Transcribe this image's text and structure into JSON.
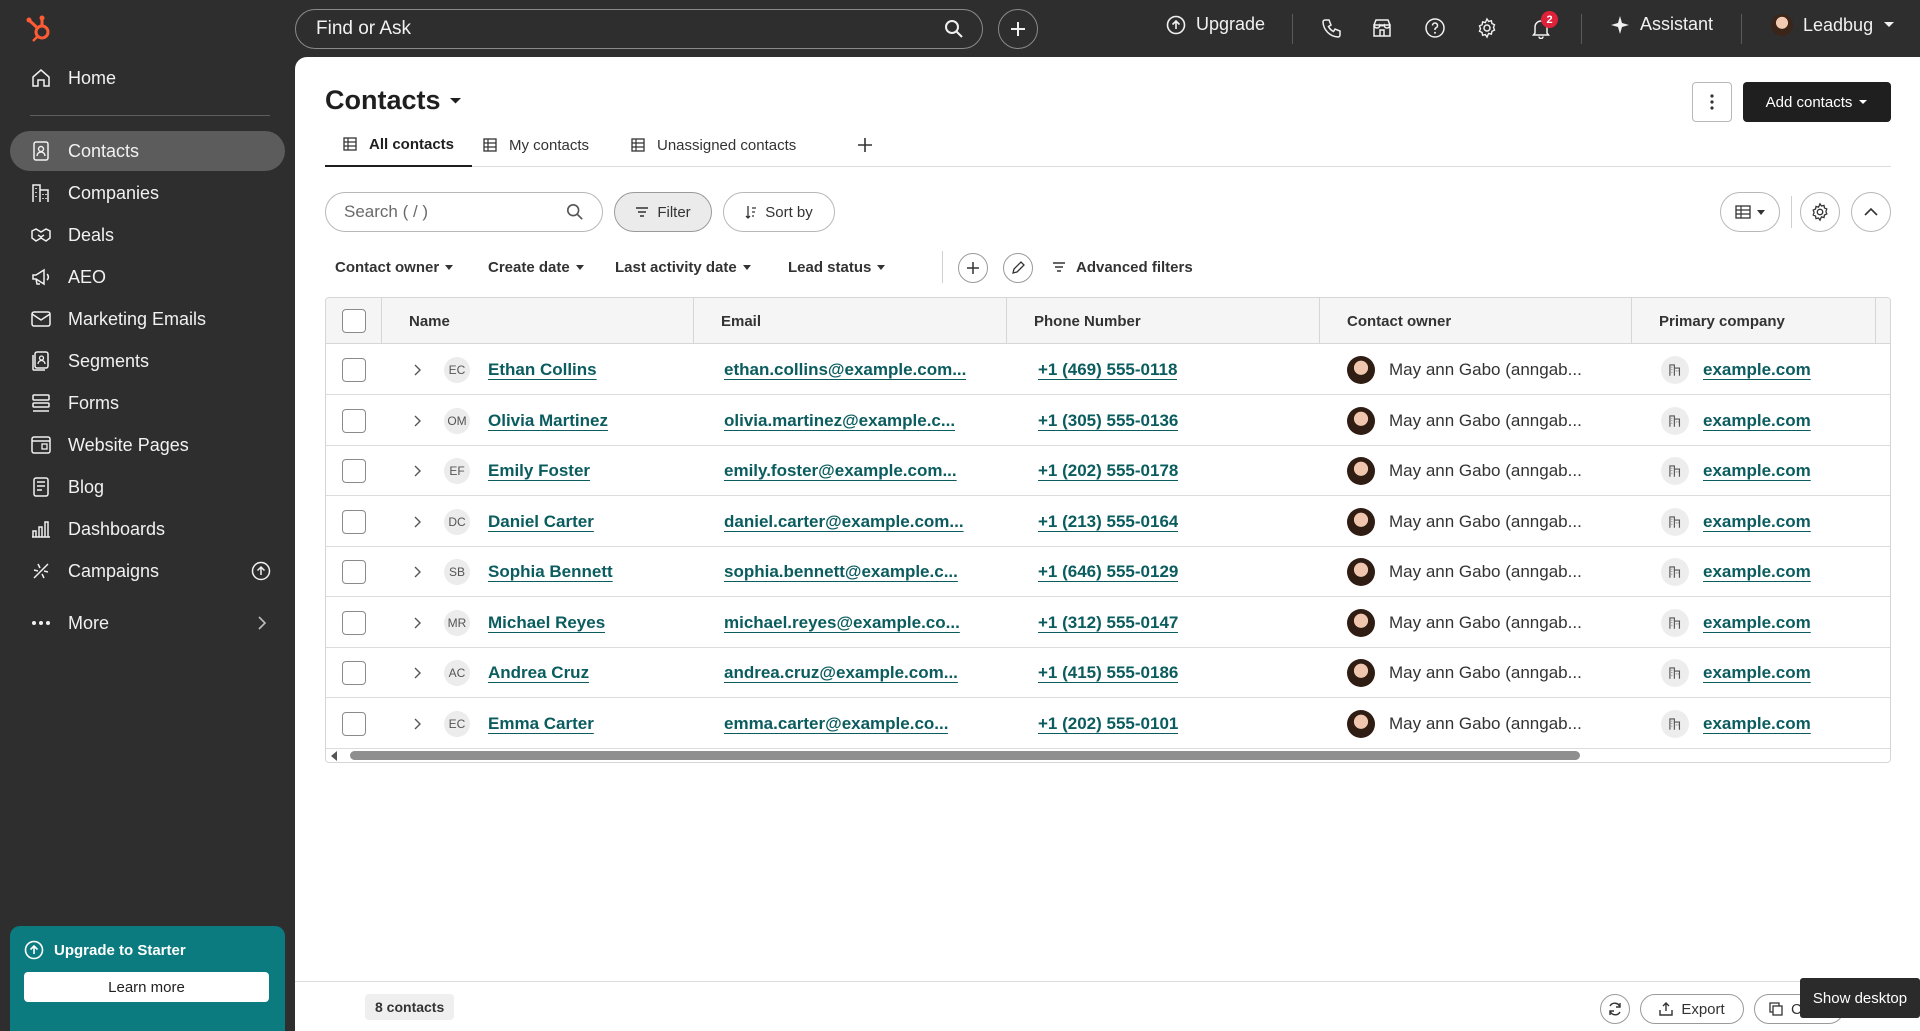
{
  "topbar": {
    "search_placeholder": "Find or Ask",
    "upgrade_label": "Upgrade",
    "notification_count": "2",
    "assistant_label": "Assistant",
    "account_name": "Leadbug"
  },
  "sidebar": {
    "items": [
      {
        "label": "Home",
        "icon": "home-icon"
      },
      {
        "label": "Contacts",
        "icon": "contacts-icon",
        "active": true
      },
      {
        "label": "Companies",
        "icon": "companies-icon"
      },
      {
        "label": "Deals",
        "icon": "deals-icon"
      },
      {
        "label": "AEO",
        "icon": "megaphone-icon"
      },
      {
        "label": "Marketing Emails",
        "icon": "email-icon"
      },
      {
        "label": "Segments",
        "icon": "segments-icon"
      },
      {
        "label": "Forms",
        "icon": "forms-icon"
      },
      {
        "label": "Website Pages",
        "icon": "website-icon"
      },
      {
        "label": "Blog",
        "icon": "blog-icon"
      },
      {
        "label": "Dashboards",
        "icon": "dashboards-icon"
      },
      {
        "label": "Campaigns",
        "icon": "campaigns-icon"
      },
      {
        "label": "More",
        "icon": "more-icon"
      }
    ],
    "upgrade_card": {
      "title": "Upgrade to Starter",
      "button": "Learn more"
    }
  },
  "page": {
    "title": "Contacts",
    "add_contacts_label": "Add contacts",
    "tabs": [
      "All contacts",
      "My contacts",
      "Unassigned contacts"
    ],
    "search_placeholder": "Search ( / )",
    "filter_label": "Filter",
    "sort_label": "Sort by",
    "quick_filters": [
      "Contact owner",
      "Create date",
      "Last activity date",
      "Lead status"
    ],
    "advanced_filters_label": "Advanced filters"
  },
  "table": {
    "columns": [
      "Name",
      "Email",
      "Phone Number",
      "Contact owner",
      "Primary company"
    ],
    "rows": [
      {
        "initials": "EC",
        "name": "Ethan Collins",
        "email": "ethan.collins@example.com...",
        "phone": "+1 (469) 555-0118",
        "owner": "May ann Gabo (anngab...",
        "company": "example.com"
      },
      {
        "initials": "OM",
        "name": "Olivia Martinez",
        "email": "olivia.martinez@example.c...",
        "phone": "+1 (305) 555-0136",
        "owner": "May ann Gabo (anngab...",
        "company": "example.com"
      },
      {
        "initials": "EF",
        "name": "Emily Foster",
        "email": "emily.foster@example.com...",
        "phone": "+1 (202) 555-0178",
        "owner": "May ann Gabo (anngab...",
        "company": "example.com"
      },
      {
        "initials": "DC",
        "name": "Daniel Carter",
        "email": "daniel.carter@example.com...",
        "phone": "+1 (213) 555-0164",
        "owner": "May ann Gabo (anngab...",
        "company": "example.com"
      },
      {
        "initials": "SB",
        "name": "Sophia Bennett",
        "email": "sophia.bennett@example.c...",
        "phone": "+1 (646) 555-0129",
        "owner": "May ann Gabo (anngab...",
        "company": "example.com"
      },
      {
        "initials": "MR",
        "name": "Michael Reyes",
        "email": "michael.reyes@example.co...",
        "phone": "+1 (312) 555-0147",
        "owner": "May ann Gabo (anngab...",
        "company": "example.com"
      },
      {
        "initials": "AC",
        "name": "Andrea Cruz",
        "email": "andrea.cruz@example.com...",
        "phone": "+1 (415) 555-0186",
        "owner": "May ann Gabo (anngab...",
        "company": "example.com"
      },
      {
        "initials": "EC",
        "name": "Emma Carter",
        "email": "emma.carter@example.co...",
        "phone": "+1 (202) 555-0101",
        "owner": "May ann Gabo (anngab...",
        "company": "example.com"
      }
    ]
  },
  "footer": {
    "count_label": "8 contacts",
    "export_label": "Export",
    "copy_label": "C",
    "show_desktop": "Show desktop"
  },
  "colors": {
    "sidebar_bg": "#2e2e2e",
    "accent_teal": "#0b7b7f",
    "link": "#0b5c5e",
    "notification": "#e0213a"
  }
}
